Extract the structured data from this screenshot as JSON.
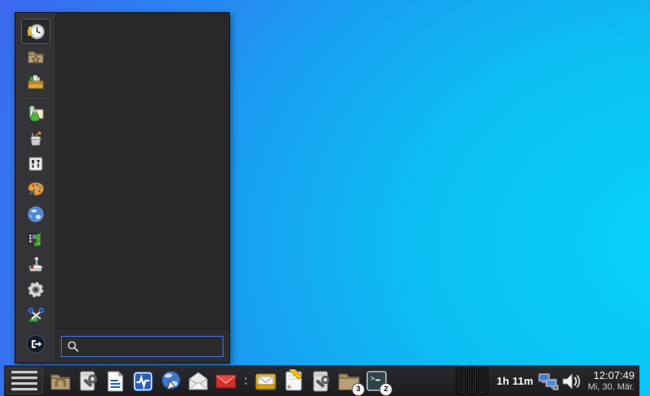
{
  "desktop": {
    "wallpaper_colors": {
      "left_blue": "#3f63ee",
      "mid_blue": "#18a0f2",
      "right_cyan": "#06d4fa"
    }
  },
  "app_menu": {
    "search": {
      "value": "",
      "placeholder": ""
    },
    "accent_border_color": "#4a72d4",
    "sidebar_items": [
      {
        "name": "recently-used",
        "icon": "history-clock-icon",
        "selected": true
      },
      {
        "name": "favorites",
        "icon": "favorites-folder-icon",
        "selected": false
      },
      {
        "name": "all-applications",
        "icon": "toolbox-icon",
        "selected": false
      },
      {
        "name": "education-science",
        "icon": "science-flask-icon",
        "selected": false
      },
      {
        "name": "look-and-feel",
        "icon": "paint-bucket-icon",
        "selected": false
      },
      {
        "name": "settings",
        "icon": "control-panel-icon",
        "selected": false
      },
      {
        "name": "graphics",
        "icon": "palette-icon",
        "selected": false
      },
      {
        "name": "internet",
        "icon": "globe-icon",
        "selected": false
      },
      {
        "name": "multimedia",
        "icon": "filmstrip-note-icon",
        "selected": false
      },
      {
        "name": "games",
        "icon": "joystick-icon",
        "selected": false
      },
      {
        "name": "system",
        "icon": "gear-icon",
        "selected": false
      },
      {
        "name": "utilities",
        "icon": "scissors-icon",
        "selected": false
      }
    ],
    "logout_icon": "logout-icon"
  },
  "taskbar": {
    "menu_button_icon": "hamburger-menu-icon",
    "launchers": [
      "home-folder",
      "system-tool",
      "libreoffice-document",
      "system-monitor",
      "web-browser",
      "mail-open",
      "mail-red",
      "mail-tray",
      "text-editor",
      "file-search-tool",
      "file-manager-folder",
      "terminal"
    ],
    "folder_badge": "3",
    "terminal_badge": "2",
    "pager_desktops": 3,
    "uptime": "1h 11m",
    "tray_icons": [
      "network-monitor-icon",
      "volume-speaker-icon"
    ]
  },
  "clock": {
    "time": "12:07:49",
    "date": "Mi, 30. Mär."
  }
}
